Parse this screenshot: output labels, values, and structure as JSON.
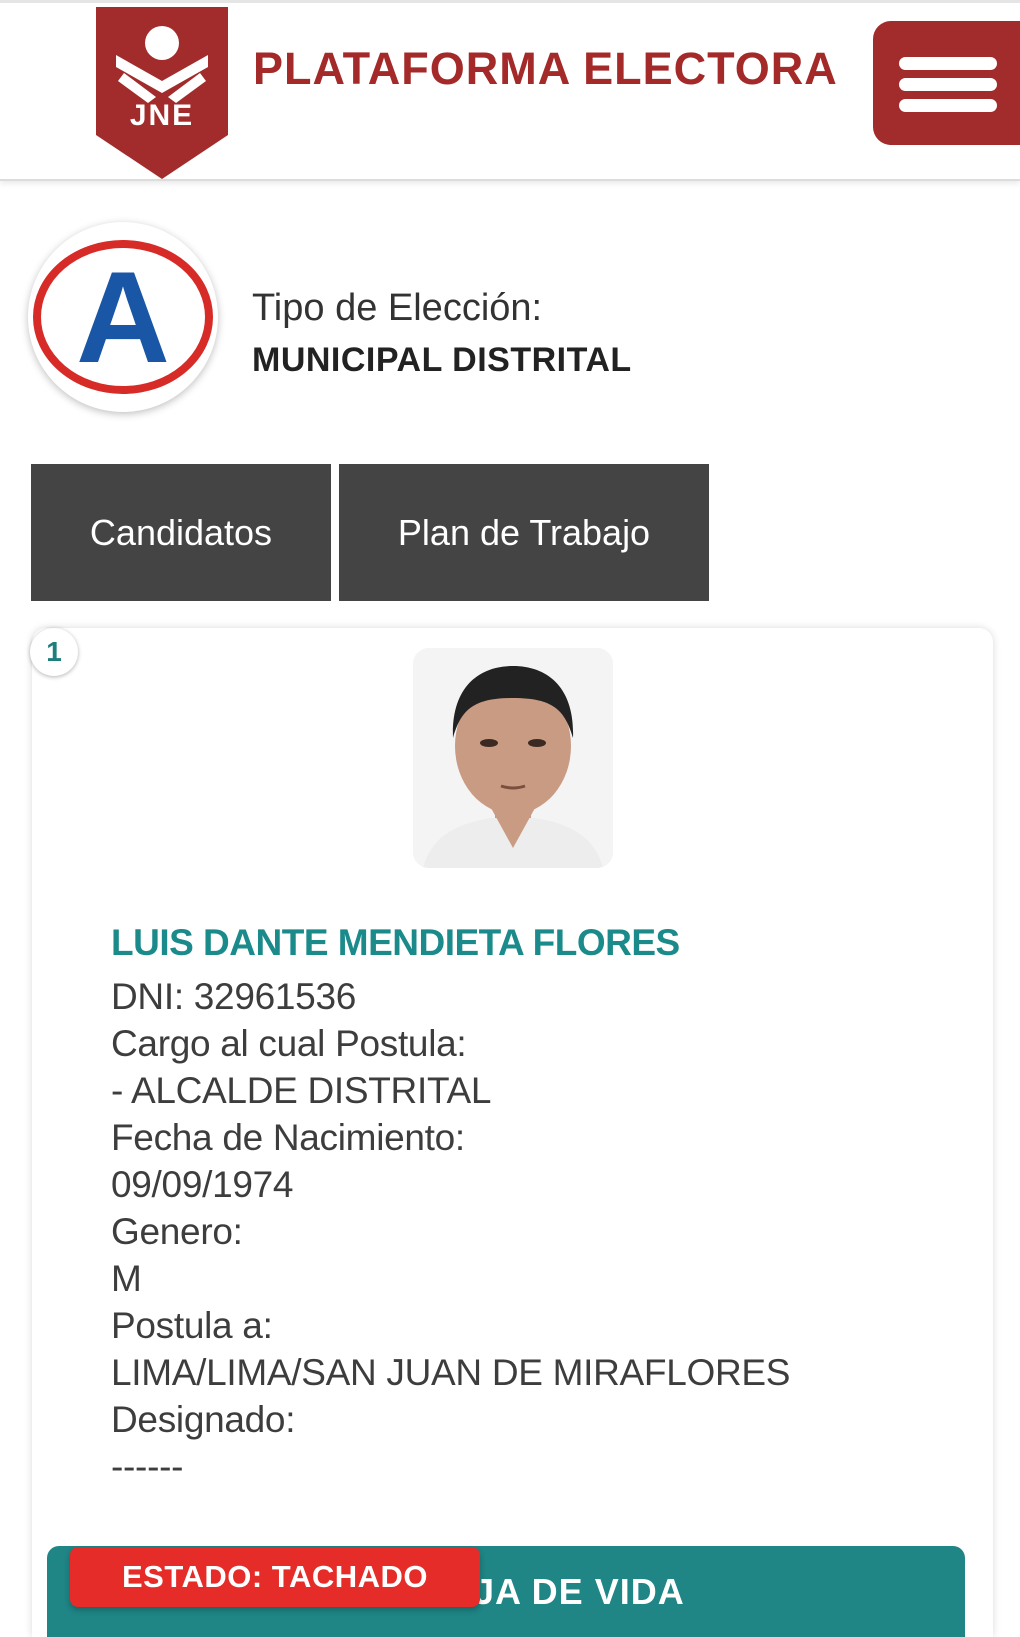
{
  "header": {
    "logo_text": "JNE",
    "title": "PLATAFORMA ELECTORA",
    "brand_color": "#a42a29",
    "menu_icon": "hamburger-menu-icon"
  },
  "election": {
    "party_logo_letter": "A",
    "type_label": "Tipo de Elección:",
    "type_value": "MUNICIPAL DISTRITAL"
  },
  "tabs": [
    {
      "label": "Candidatos"
    },
    {
      "label": "Plan de Trabajo"
    }
  ],
  "candidate": {
    "number": "1",
    "name": "LUIS DANTE MENDIETA FLORES",
    "dni": "DNI: 32961536",
    "cargo_label": "Cargo al cual Postula:",
    "cargo_value": "- ALCALDE DISTRITAL",
    "birth_label": "Fecha de Nacimiento:",
    "birth_value": "09/09/1974",
    "gender_label": "Genero:",
    "gender_value": "M",
    "postula_label": "Postula a:",
    "postula_value": "LIMA/LIMA/SAN JUAN DE MIRAFLORES",
    "designado_label": "Designado:",
    "designado_value": "------"
  },
  "actions": {
    "hoja_de_vida_label": "JA DE VIDA",
    "status_badge": "ESTADO: TACHADO",
    "accent_color": "#1f8585",
    "status_color": "#e52c28"
  }
}
